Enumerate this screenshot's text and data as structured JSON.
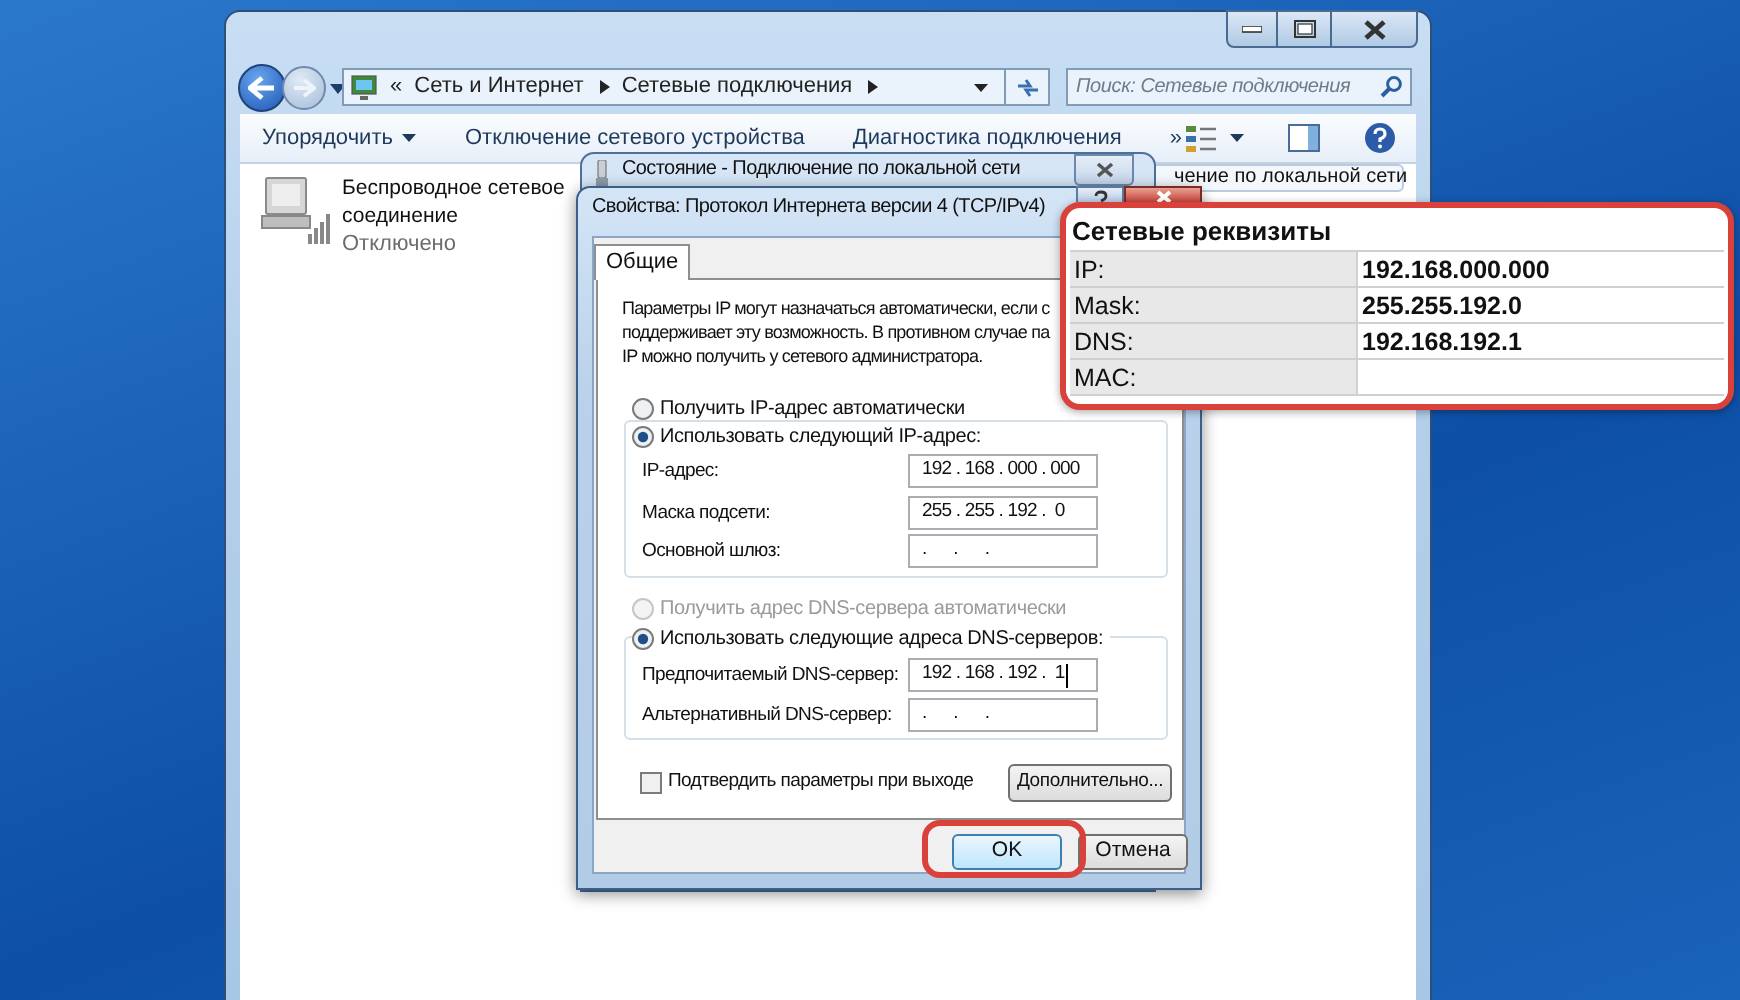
{
  "explorer": {
    "address_bar": {
      "prefix": "«",
      "breadcrumbs": [
        "Сеть и Интернет",
        "Сетевые подключения"
      ]
    },
    "search": {
      "placeholder": "Поиск: Сетевые подключения"
    },
    "toolbar": [
      {
        "label": "Упорядочить",
        "dropdown": true
      },
      {
        "label": "Отключение сетевого устройства",
        "dropdown": false
      },
      {
        "label": "Диагностика подключения",
        "dropdown": false
      },
      {
        "label": "»",
        "dropdown": false
      }
    ],
    "items": [
      {
        "name": "Беспроводное сетевое соединение",
        "status": "Отключено",
        "selected": false
      },
      {
        "name": "чение по локальной сети",
        "selected": true
      }
    ]
  },
  "status_window": {
    "title": "Состояние - Подключение по локальной сети"
  },
  "dialog": {
    "title": "Свойства: Протокол Интернета версии 4 (TCP/IPv4)",
    "tabs": [
      {
        "label": "Общие",
        "selected": true
      }
    ],
    "intro_lines": [
      "Параметры IP могут назначаться автоматически, если с",
      "поддерживает эту возможность. В противном случае па",
      "IP можно получить у сетевого администратора."
    ],
    "ip_options": [
      {
        "label": "Получить IP-адрес автоматически",
        "selected": false,
        "disabled": false
      },
      {
        "label": "Использовать следующий IP-адрес:",
        "selected": true,
        "disabled": false
      }
    ],
    "ip_fields": [
      {
        "label": "IP-адрес:",
        "value": "192 . 168 . 000 . 000",
        "cursor": false
      },
      {
        "label": "Маска подсети:",
        "value": "255 . 255 . 192 .  0",
        "cursor": false
      },
      {
        "label": "Основной шлюз:",
        "value": ".      .      .",
        "cursor": false
      }
    ],
    "dns_options": [
      {
        "label": "Получить адрес DNS-сервера автоматически",
        "selected": false,
        "disabled": true
      },
      {
        "label": "Использовать следующие адреса DNS-серверов:",
        "selected": true,
        "disabled": false
      }
    ],
    "dns_fields": [
      {
        "label": "Предпочитаемый DNS-сервер:",
        "value": "192 . 168 . 192 .  1",
        "cursor": true
      },
      {
        "label": "Альтернативный DNS-сервер:",
        "value": ".      .      .",
        "cursor": false
      }
    ],
    "confirm": {
      "label": "Подтвердить параметры при выходе",
      "checked": false
    },
    "advanced_button": "Дополнительно...",
    "buttons": [
      {
        "label": "OK",
        "default": true,
        "annotated": true
      },
      {
        "label": "Отмена",
        "default": false,
        "annotated": false
      }
    ]
  },
  "annotation": {
    "title": "Сетевые реквизиты",
    "rows": [
      {
        "label": "IP:",
        "value": "192.168.000.000"
      },
      {
        "label": "Mask:",
        "value": "255.255.192.0"
      },
      {
        "label": "DNS:",
        "value": "192.168.192.1"
      },
      {
        "label": "MAC:"
      }
    ]
  }
}
